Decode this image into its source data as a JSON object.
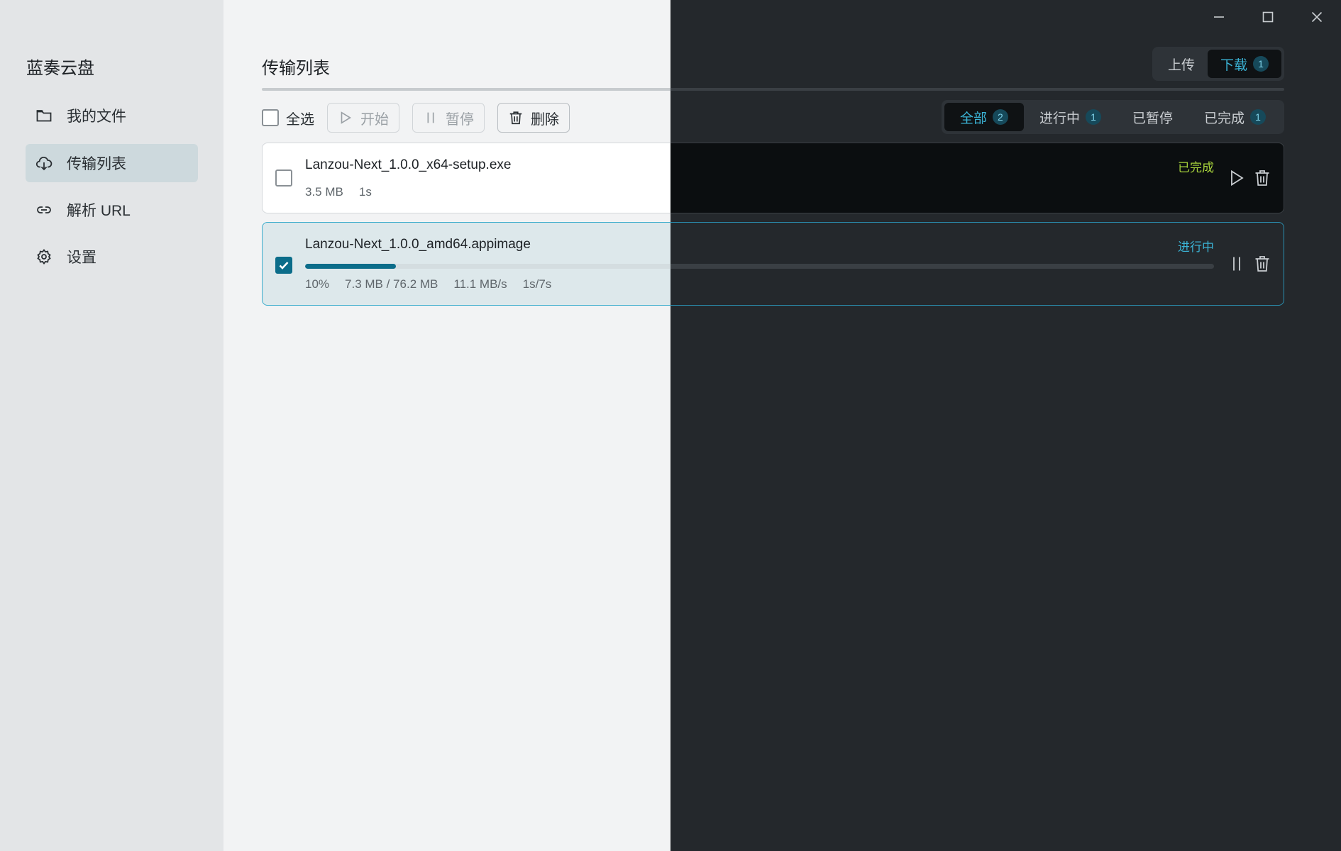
{
  "app": {
    "name": "蓝奏云盘"
  },
  "sidebar": {
    "items": [
      {
        "label": "我的文件",
        "icon": "folder-icon",
        "active": false
      },
      {
        "label": "传输列表",
        "icon": "cloud-download-icon",
        "active": true
      },
      {
        "label": "解析 URL",
        "icon": "link-icon",
        "active": false
      },
      {
        "label": "设置",
        "icon": "gear-icon",
        "active": false
      }
    ]
  },
  "window_controls": {
    "minimize": "minimize-icon",
    "maximize": "maximize-icon",
    "close": "close-icon"
  },
  "page": {
    "title": "传输列表"
  },
  "direction_tabs": [
    {
      "label": "上传",
      "active": false,
      "badge": ""
    },
    {
      "label": "下载",
      "active": true,
      "badge": "1"
    }
  ],
  "toolbar": {
    "select_all_label": "全选",
    "start_label": "开始",
    "pause_label": "暂停",
    "delete_label": "删除"
  },
  "filter_tabs": [
    {
      "label": "全部",
      "active": true,
      "badge": "2"
    },
    {
      "label": "进行中",
      "active": false,
      "badge": "1"
    },
    {
      "label": "已暂停",
      "active": false,
      "badge": ""
    },
    {
      "label": "已完成",
      "active": false,
      "badge": "1"
    }
  ],
  "tasks": [
    {
      "name": "Lanzou-Next_1.0.0_x64-setup.exe",
      "size": "3.5 MB",
      "time": "1s",
      "status": "已完成",
      "checked": false
    },
    {
      "name": "Lanzou-Next_1.0.0_amd64.appimage",
      "percent_text": "10%",
      "progress": 0.1,
      "transferred": "7.3 MB / 76.2 MB",
      "speed": "11.1 MB/s",
      "time": "1s/7s",
      "status": "进行中",
      "checked": true
    }
  ],
  "colors": {
    "accent": "#0b6d8a",
    "active_text": "#3bb4d6",
    "done": "#a6d13b"
  }
}
